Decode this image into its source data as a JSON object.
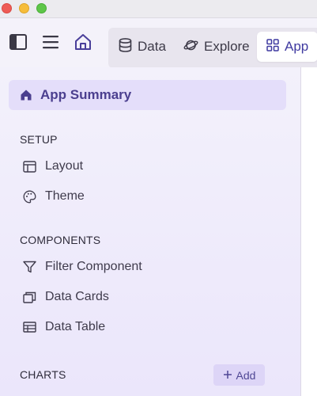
{
  "toolbar": {
    "tabs": [
      {
        "label": "Data",
        "icon": "database-icon"
      },
      {
        "label": "Explore",
        "icon": "planet-icon"
      },
      {
        "label": "App",
        "icon": "grid-icon"
      }
    ],
    "active_tab": "App"
  },
  "sidebar": {
    "summary_label": "App Summary",
    "sections": [
      {
        "title": "SETUP",
        "items": [
          {
            "label": "Layout",
            "icon": "layout-icon"
          },
          {
            "label": "Theme",
            "icon": "palette-icon"
          }
        ]
      },
      {
        "title": "COMPONENTS",
        "items": [
          {
            "label": "Filter Component",
            "icon": "filter-icon"
          },
          {
            "label": "Data Cards",
            "icon": "cards-icon"
          },
          {
            "label": "Data Table",
            "icon": "table-icon"
          }
        ]
      },
      {
        "title": "CHARTS",
        "items": []
      }
    ],
    "add_label": "Add"
  },
  "colors": {
    "accent": "#3f3aa0",
    "sidebar_bg": "#efecfb",
    "active_item_bg": "#e4defa"
  }
}
